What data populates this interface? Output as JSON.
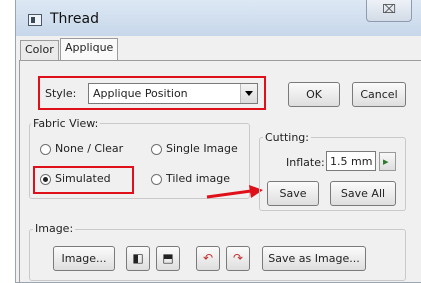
{
  "window": {
    "title": "Thread",
    "close_glyph": "⌧"
  },
  "tabs": [
    {
      "label": "Color",
      "active": false
    },
    {
      "label": "Applique",
      "active": true
    }
  ],
  "style": {
    "label": "Style:",
    "value": "Applique Position"
  },
  "buttons": {
    "ok": "OK",
    "cancel": "Cancel"
  },
  "fabric_view": {
    "label": "Fabric View:",
    "options": [
      {
        "label": "None / Clear",
        "selected": false
      },
      {
        "label": "Single Image",
        "selected": false
      },
      {
        "label": "Simulated",
        "selected": true
      },
      {
        "label": "Tiled image",
        "selected": false
      }
    ]
  },
  "cutting": {
    "label": "Cutting:",
    "inflate_label": "Inflate:",
    "inflate_value": "1.5 mm",
    "save": "Save",
    "save_all": "Save All"
  },
  "image": {
    "label": "Image:",
    "image_button": "Image...",
    "save_as_image": "Save as Image..."
  },
  "colors": {
    "highlight": "#e0101a",
    "arrow": "#e0101a"
  },
  "icons": [
    "flip-horizontal-icon",
    "flip-vertical-icon",
    "rotate-left-icon",
    "rotate-right-icon",
    "spin-arrow-icon"
  ]
}
